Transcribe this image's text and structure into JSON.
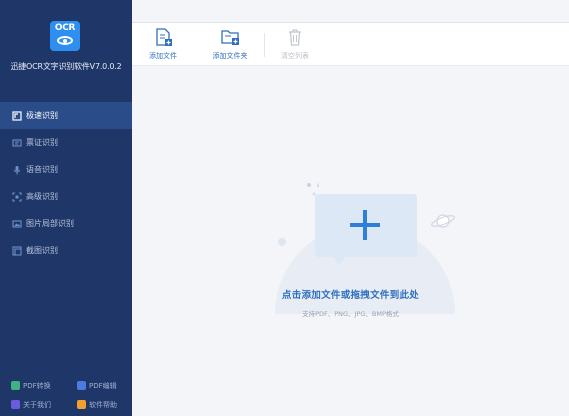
{
  "app": {
    "logo_text": "OCR",
    "title": "迅捷OCR文字识别软件V7.0.0.2"
  },
  "sidebar": {
    "items": [
      {
        "label": "极速识别",
        "icon": "speed-scan-icon",
        "active": true
      },
      {
        "label": "票证识别",
        "icon": "ticket-icon",
        "active": false
      },
      {
        "label": "语音识别",
        "icon": "microphone-icon",
        "active": false
      },
      {
        "label": "高级识别",
        "icon": "advanced-scan-icon",
        "active": false
      },
      {
        "label": "图片局部识别",
        "icon": "image-crop-icon",
        "active": false
      },
      {
        "label": "截图识别",
        "icon": "screenshot-icon",
        "active": false
      }
    ],
    "footer": [
      {
        "label": "PDF转换",
        "icon": "pdf-convert-icon",
        "color": "#3fb37f"
      },
      {
        "label": "PDF编辑",
        "icon": "pdf-edit-icon",
        "color": "#4a7be0"
      },
      {
        "label": "关于我们",
        "icon": "about-icon",
        "color": "#6a5be0"
      },
      {
        "label": "软件帮助",
        "icon": "help-icon",
        "color": "#f0a030"
      }
    ]
  },
  "toolbar": {
    "add_file": "添加文件",
    "add_folder": "添加文件夹",
    "clear_list": "清空列表"
  },
  "dropzone": {
    "title": "点击添加文件或拖拽文件到此处",
    "hint": "支持PDF、PNG、JPG、BMP格式"
  },
  "colors": {
    "sidebar_bg": "#1f3768",
    "sidebar_active": "#2a4d8a",
    "accent": "#2f6fbf",
    "logo_bg": "#2e8ff0"
  }
}
